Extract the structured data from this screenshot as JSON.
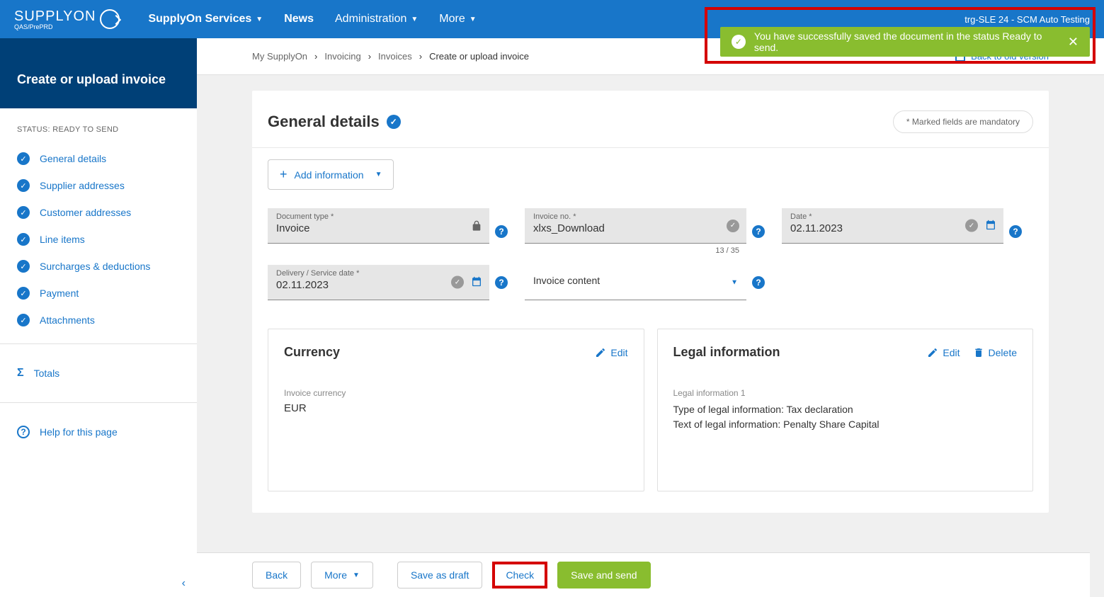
{
  "header": {
    "logo_main": "SUPPLYON",
    "logo_sub": "QAS/PrePRD",
    "nav": {
      "services": "SupplyOn Services",
      "news": "News",
      "admin": "Administration",
      "more": "More"
    },
    "user": "trg-SLE 24 - SCM Auto Testing"
  },
  "notification": {
    "text": "You have successfully saved the document in the status Ready to send."
  },
  "sidebar": {
    "title": "Create or upload invoice",
    "status": "STATUS: READY TO SEND",
    "items": [
      {
        "label": "General details"
      },
      {
        "label": "Supplier addresses"
      },
      {
        "label": "Customer addresses"
      },
      {
        "label": "Line items"
      },
      {
        "label": "Surcharges & deductions"
      },
      {
        "label": "Payment"
      },
      {
        "label": "Attachments"
      }
    ],
    "totals": "Totals",
    "help": "Help for this page"
  },
  "breadcrumb": {
    "items": [
      "My SupplyOn",
      "Invoicing",
      "Invoices"
    ],
    "current": "Create or upload invoice",
    "back_old": "Back to old version"
  },
  "general": {
    "title": "General details",
    "mandatory": "* Marked fields are mandatory",
    "add_info": "Add information",
    "fields": {
      "doc_type": {
        "label": "Document type *",
        "value": "Invoice"
      },
      "invoice_no": {
        "label": "Invoice no. *",
        "value": "xlxs_Download",
        "counter": "13 / 35"
      },
      "date": {
        "label": "Date *",
        "value": "02.11.2023"
      },
      "delivery": {
        "label": "Delivery / Service date *",
        "value": "02.11.2023"
      },
      "content": {
        "label": "Invoice content"
      }
    }
  },
  "currency": {
    "title": "Currency",
    "edit": "Edit",
    "label": "Invoice currency",
    "value": "EUR"
  },
  "legal": {
    "title": "Legal information",
    "edit": "Edit",
    "delete": "Delete",
    "sub_label": "Legal information 1",
    "line1": "Type of legal information: Tax declaration",
    "line2": "Text of legal information: Penalty Share Capital"
  },
  "footer": {
    "back": "Back",
    "more": "More",
    "draft": "Save as draft",
    "check": "Check",
    "save_send": "Save and send"
  }
}
